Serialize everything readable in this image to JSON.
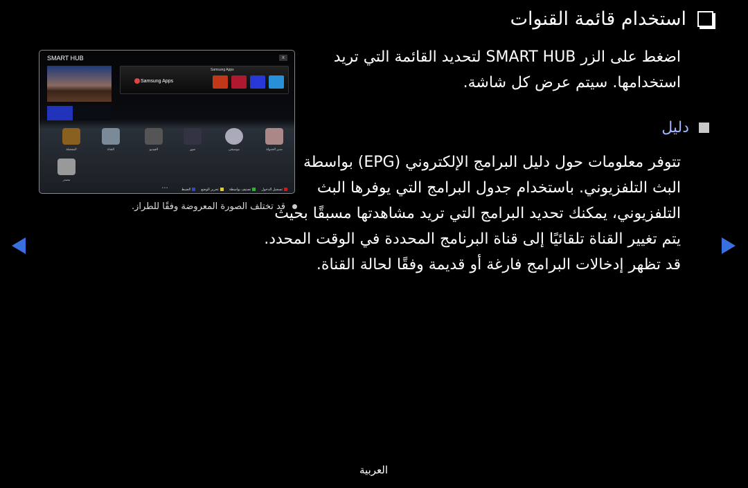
{
  "title": "استخدام قائمة القنوات",
  "intro": [
    "اضغط على الزر SMART HUB لتحديد القائمة التي تريد",
    "استخدامها. سيتم عرض كل شاشة."
  ],
  "section_heading": "دليل",
  "paragraph": [
    "تتوفر معلومات حول دليل البرامج الإلكتروني (EPG) بواسطة",
    "البث التلفزيوني. باستخدام جدول البرامج التي يوفرها البث",
    "التلفزيوني، يمكنك تحديد البرامج التي تريد مشاهدتها مسبقًا بحيث",
    "يتم تغيير القناة تلقائيًا إلى قناة البرنامج المحددة في الوقت المحدد.",
    "قد تظهر إدخالات البرامج فارغة أو قديمة وفقًا لحالة القناة."
  ],
  "note": "قد تختلف الصورة المعروضة وفقًا للطراز.",
  "footer": "العربية",
  "screen": {
    "logo": "SMART HUB",
    "close": "x",
    "apps_title": "Samsung Apps",
    "apps_label": "Samsung Apps",
    "icons": [
      "المفضلة",
      "القناة",
      "الفيديو",
      "صور",
      "موسيقى",
      "مدير الجدولة",
      "مصدر"
    ],
    "pager": "• • •",
    "buttons": [
      {
        "key": "A",
        "label": "تسجيل الدخول",
        "color": "#d01818"
      },
      {
        "key": "B",
        "label": "تصنيف بواسطة",
        "color": "#2bb52b"
      },
      {
        "key": "C",
        "label": "تحرير الوضع",
        "color": "#e0d020"
      },
      {
        "key": "D",
        "label": "الضبط",
        "color": "#2848d0"
      }
    ]
  },
  "colors": {
    "accent": "#3a6fe0",
    "heading": "#9fb7ff"
  }
}
